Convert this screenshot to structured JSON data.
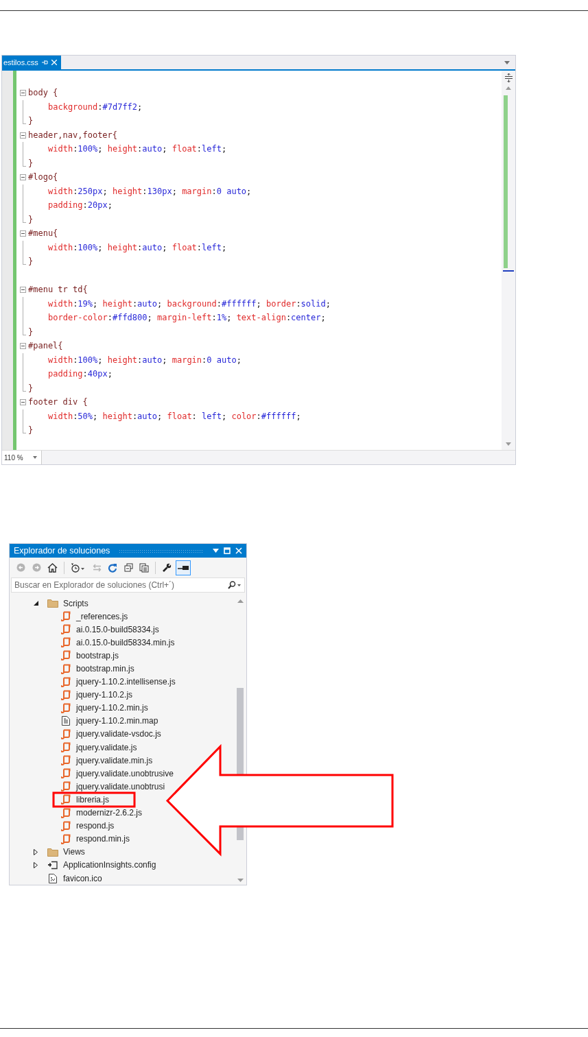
{
  "editor": {
    "tab": {
      "label": "estilos.css",
      "selected": true
    },
    "lines": [
      {
        "kind": "selector",
        "text": "body {"
      },
      {
        "kind": "decl",
        "text": "background:#7d7ff2;"
      },
      {
        "kind": "close",
        "text": "}"
      },
      {
        "kind": "selector",
        "text": "header,nav,footer{"
      },
      {
        "kind": "decl",
        "text": "width:100%; height:auto; float:left;"
      },
      {
        "kind": "close",
        "text": "}"
      },
      {
        "kind": "selector",
        "text": "#logo{"
      },
      {
        "kind": "decl",
        "text": "width:250px; height:130px; margin:0 auto;"
      },
      {
        "kind": "decl",
        "text": "padding:20px;"
      },
      {
        "kind": "close",
        "text": "}"
      },
      {
        "kind": "selector",
        "text": "#menu{"
      },
      {
        "kind": "decl",
        "text": "width:100%; height:auto; float:left;"
      },
      {
        "kind": "close",
        "text": "}"
      },
      {
        "kind": "blank"
      },
      {
        "kind": "selector",
        "text": "#menu tr td{"
      },
      {
        "kind": "decl",
        "text": "width:19%; height:auto; background:#ffffff; border:solid;"
      },
      {
        "kind": "decl",
        "text": "border-color:#ffd800; margin-left:1%; text-align:center;"
      },
      {
        "kind": "close",
        "text": "}"
      },
      {
        "kind": "selector",
        "text": "#panel{"
      },
      {
        "kind": "decl",
        "text": "width:100%; height:auto; margin:0 auto;"
      },
      {
        "kind": "decl",
        "text": "padding:40px;"
      },
      {
        "kind": "close",
        "text": "}"
      },
      {
        "kind": "selector",
        "text": "footer div {"
      },
      {
        "kind": "decl",
        "text": "width:50%; height:auto; float: left; color:#ffffff;"
      },
      {
        "kind": "close",
        "text": "}"
      }
    ],
    "zoom": "110 %"
  },
  "solution_explorer": {
    "title": "Explorador de soluciones",
    "toolbar": {
      "back_disabled": true,
      "forward_disabled": true,
      "sync_disabled": true,
      "preview_selected": true
    },
    "search": {
      "placeholder": "Buscar en Explorador de soluciones (Ctrl+´)"
    },
    "tree": [
      {
        "label": "Scripts",
        "kind": "folder",
        "expanded": true,
        "children": [
          {
            "label": "_references.js",
            "kind": "script"
          },
          {
            "label": "ai.0.15.0-build58334.js",
            "kind": "script"
          },
          {
            "label": "ai.0.15.0-build58334.min.js",
            "kind": "script"
          },
          {
            "label": "bootstrap.js",
            "kind": "script"
          },
          {
            "label": "bootstrap.min.js",
            "kind": "script"
          },
          {
            "label": "jquery-1.10.2.intellisense.js",
            "kind": "script"
          },
          {
            "label": "jquery-1.10.2.js",
            "kind": "script"
          },
          {
            "label": "jquery-1.10.2.min.js",
            "kind": "script"
          },
          {
            "label": "jquery-1.10.2.min.map",
            "kind": "map"
          },
          {
            "label": "jquery.validate-vsdoc.js",
            "kind": "script"
          },
          {
            "label": "jquery.validate.js",
            "kind": "script"
          },
          {
            "label": "jquery.validate.min.js",
            "kind": "script"
          },
          {
            "label": "jquery.validate.unobtrusive",
            "kind": "script"
          },
          {
            "label": "jquery.validate.unobtrusi",
            "kind": "script"
          },
          {
            "label": "libreria.js",
            "kind": "script"
          },
          {
            "label": "modernizr-2.6.2.js",
            "kind": "script"
          },
          {
            "label": "respond.js",
            "kind": "script"
          },
          {
            "label": "respond.min.js",
            "kind": "script"
          }
        ]
      },
      {
        "label": "Views",
        "kind": "folder",
        "expanded": false
      },
      {
        "label": "ApplicationInsights.config",
        "kind": "config",
        "expanded": false
      },
      {
        "label": "favicon.ico",
        "kind": "image"
      }
    ]
  }
}
